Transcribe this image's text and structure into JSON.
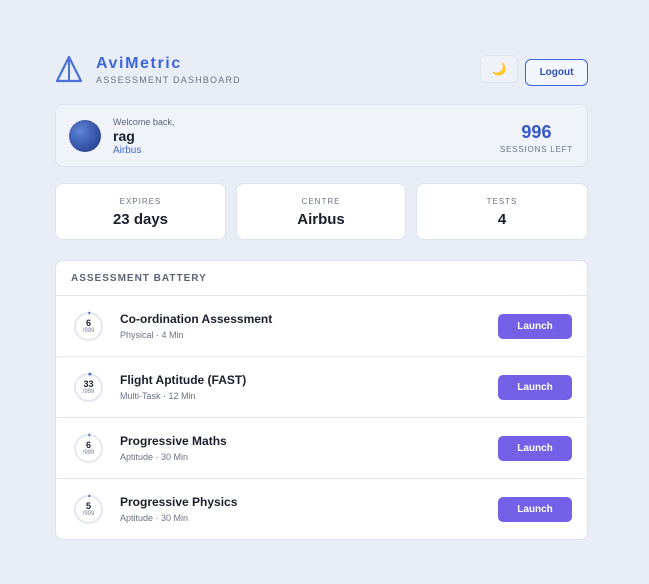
{
  "brand": {
    "name": "AviMetric",
    "subtitle": "ASSESSMENT DASHBOARD",
    "icon": "sail-triangle-icon"
  },
  "header": {
    "theme_icon": "🌙",
    "logout_label": "Logout"
  },
  "welcome": {
    "greeting": "Welcome back,",
    "user_name": "rag",
    "organisation": "Airbus",
    "sessions_left": "996",
    "sessions_label": "SESSIONS LEFT"
  },
  "stats": [
    {
      "label": "EXPIRES",
      "value": "23 days"
    },
    {
      "label": "CENTRE",
      "value": "Airbus"
    },
    {
      "label": "TESTS",
      "value": "4"
    }
  ],
  "battery": {
    "title": "ASSESSMENT BATTERY",
    "tests": [
      {
        "name": "Co-ordination Assessment",
        "meta": "Physical · 4 Min",
        "count": "6",
        "max": "/999",
        "count_value": 6,
        "max_value": 999,
        "action": "Launch"
      },
      {
        "name": "Flight Aptitude (FAST)",
        "meta": "Multi-Task · 12 Min",
        "count": "33",
        "max": "/999",
        "count_value": 33,
        "max_value": 999,
        "action": "Launch"
      },
      {
        "name": "Progressive Maths",
        "meta": "Aptitude · 30 Min",
        "count": "6",
        "max": "/999",
        "count_value": 6,
        "max_value": 999,
        "action": "Launch"
      },
      {
        "name": "Progressive Physics",
        "meta": "Aptitude · 30 Min",
        "count": "5",
        "max": "/999",
        "count_value": 5,
        "max_value": 999,
        "action": "Launch"
      }
    ]
  },
  "colors": {
    "accent": "#3f66d6",
    "launch": "#7360e6",
    "background": "#e9edf6",
    "ring_track": "#e3e7ef",
    "ring_progress": "#3f66d6"
  }
}
